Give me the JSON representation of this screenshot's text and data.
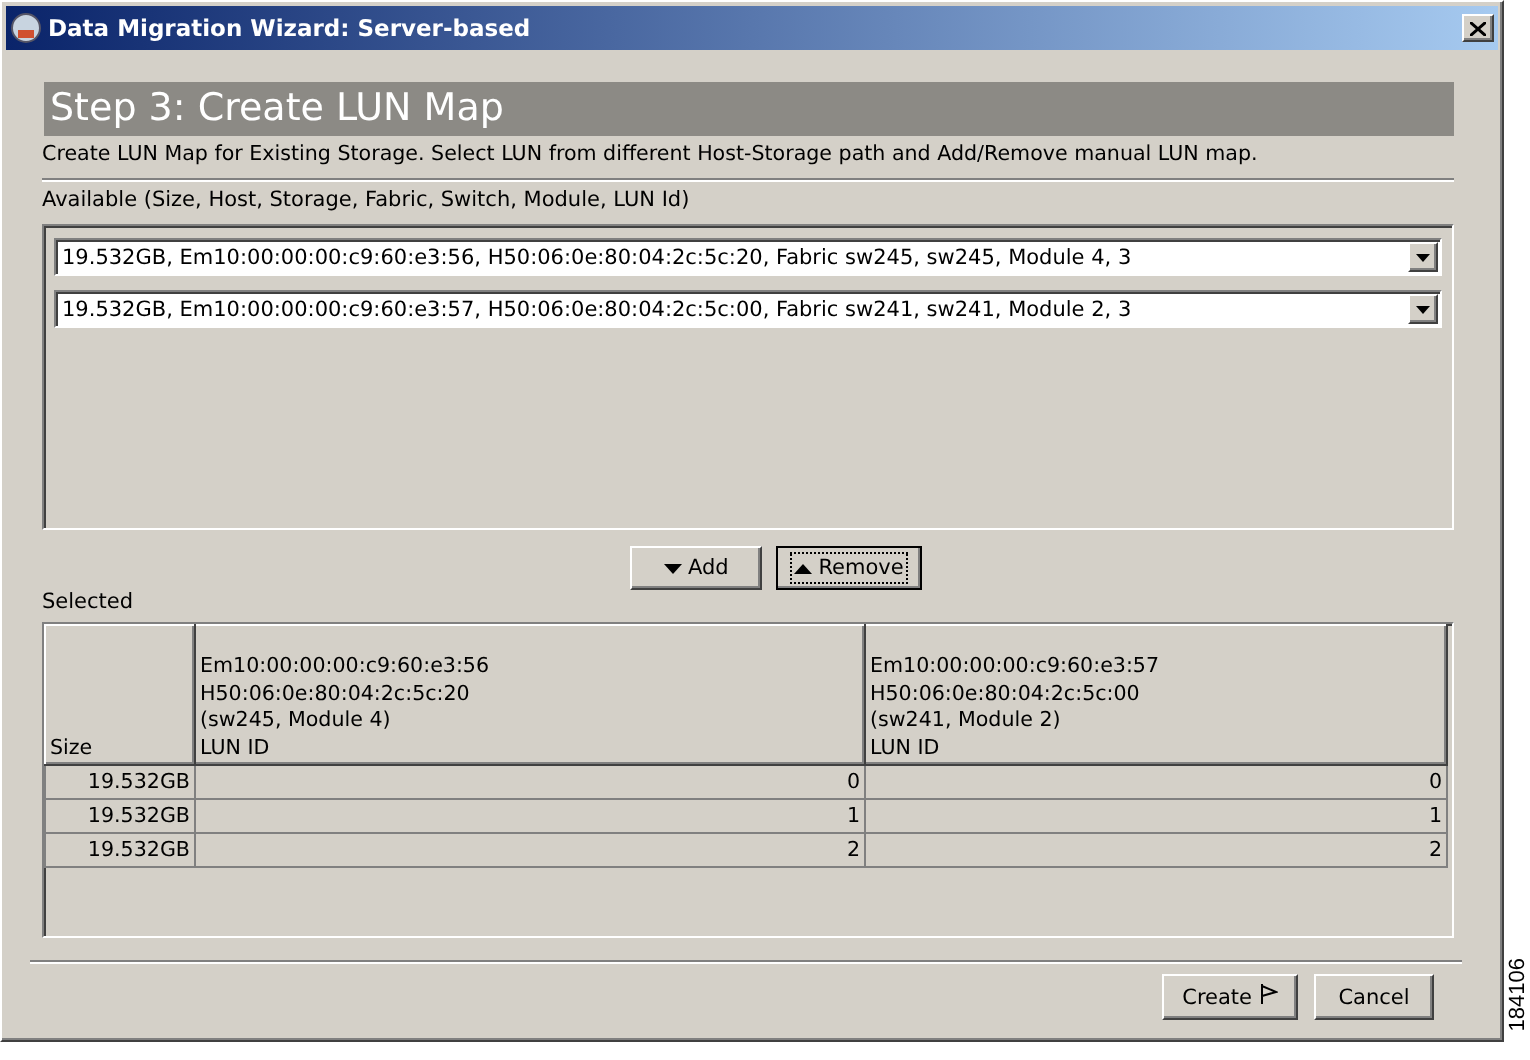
{
  "window": {
    "title": "Data Migration Wizard: Server-based"
  },
  "step": {
    "title": "Step 3: Create LUN Map",
    "description": "Create LUN Map for Existing Storage. Select LUN from different Host-Storage path and Add/Remove manual LUN map."
  },
  "available": {
    "label": "Available (Size, Host, Storage, Fabric, Switch, Module, LUN Id)",
    "items": [
      {
        "value": "19.532GB, Em10:00:00:00:c9:60:e3:56, H50:06:0e:80:04:2c:5c:20, Fabric sw245, sw245, Module 4, 3"
      },
      {
        "value": "19.532GB, Em10:00:00:00:c9:60:e3:57, H50:06:0e:80:04:2c:5c:00, Fabric sw241, sw241, Module 2, 3"
      }
    ]
  },
  "move_buttons": [
    {
      "kind": "down",
      "label": "Add",
      "focused": false
    },
    {
      "kind": "up",
      "label": "Remove",
      "focused": true
    }
  ],
  "selected": {
    "label": "Selected",
    "columns": [
      {
        "lines": [
          "Size"
        ]
      },
      {
        "lines": [
          "Em10:00:00:00:c9:60:e3:56",
          "H50:06:0e:80:04:2c:5c:20",
          "(sw245, Module 4)",
          "LUN ID"
        ]
      },
      {
        "lines": [
          "Em10:00:00:00:c9:60:e3:57",
          "H50:06:0e:80:04:2c:5c:00",
          "(sw241, Module 2)",
          "LUN ID"
        ]
      }
    ],
    "rows": [
      [
        "19.532GB",
        "0",
        "0"
      ],
      [
        "19.532GB",
        "1",
        "1"
      ],
      [
        "19.532GB",
        "2",
        "2"
      ]
    ]
  },
  "footer_buttons": [
    {
      "kind": "create",
      "label": "Create"
    },
    {
      "kind": "cancel",
      "label": "Cancel"
    }
  ],
  "figure_number": "184106"
}
